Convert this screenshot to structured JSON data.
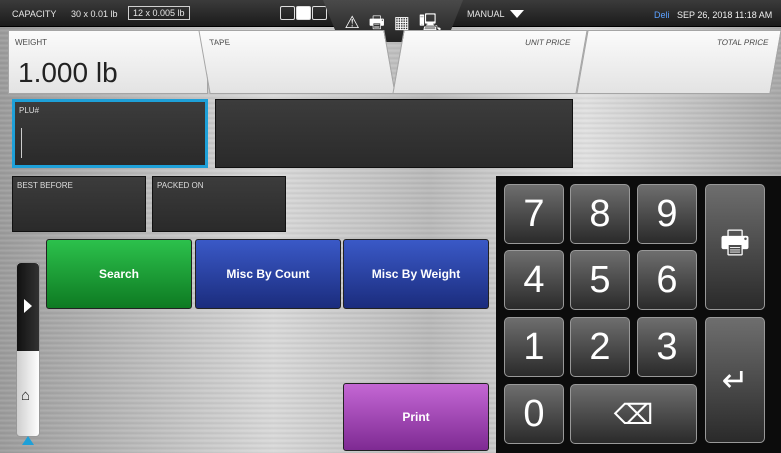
{
  "topbar": {
    "capacity_label": "CAPACITY",
    "capacity_value": "30 x 0.01 lb",
    "capacity_value2": "12 x 0.005 lb",
    "mode": "MANUAL",
    "brand": "Deli",
    "datetime": "SEP 26, 2018 11:18 AM"
  },
  "center_icons": [
    "warning-icon",
    "printer-icon",
    "grid-icon",
    "network-icon"
  ],
  "center_icon_glyphs": [
    "⚠",
    "🖶",
    "▦",
    "🖳"
  ],
  "fields": {
    "weight_label": "WEIGHT",
    "weight_value": "1.000 lb",
    "tape_label": "TAPE",
    "unit_price_label": "UNIT PRICE",
    "total_price_label": "TOTAL PRICE"
  },
  "inputs": {
    "plu_label": "PLU#",
    "best_before_label": "BEST BEFORE",
    "packed_on_label": "PACKED ON"
  },
  "buttons": {
    "search": "Search",
    "misc_by_count": "Misc By Count",
    "misc_by_weight": "Misc By Weight",
    "print": "Print"
  },
  "keypad": {
    "k7": "7",
    "k8": "8",
    "k9": "9",
    "k4": "4",
    "k5": "5",
    "k6": "6",
    "k1": "1",
    "k2": "2",
    "k3": "3",
    "k0": "0",
    "print_glyph": "🖶",
    "enter_glyph": "↵",
    "backspace_glyph": "⌫"
  },
  "side": {
    "home_glyph": "⌂"
  },
  "colors": {
    "search": "#1e9e38",
    "misc": "#2a3fa4",
    "print": "#a64abb",
    "accent_blue": "#1ea0d8"
  }
}
